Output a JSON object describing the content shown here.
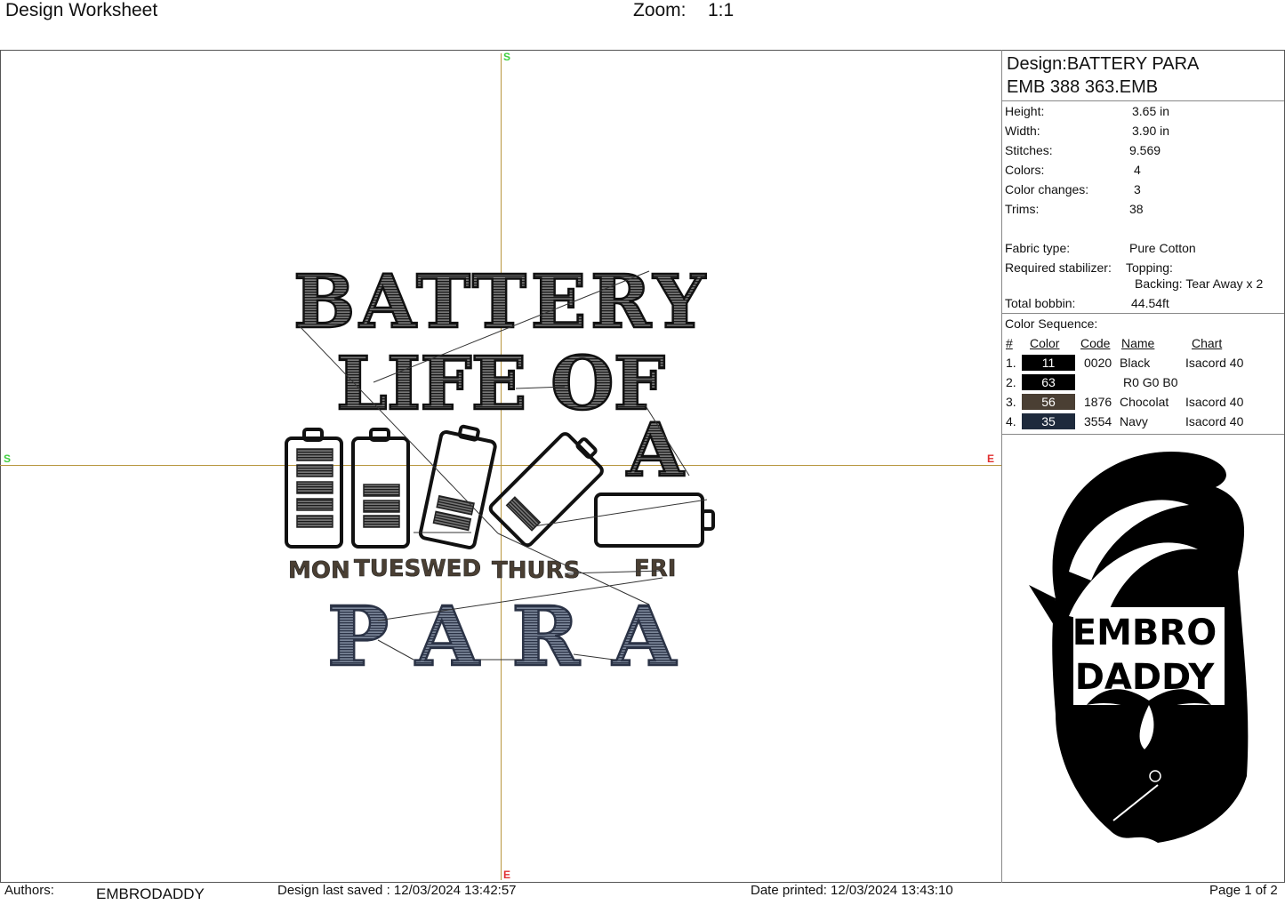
{
  "header": {
    "title": "Design Worksheet",
    "zoom_label": "Zoom:",
    "zoom_value": "1:1"
  },
  "axes": {
    "north": "S",
    "west": "S",
    "east": "E",
    "south": "E"
  },
  "design_art": {
    "line1": "BATTERY",
    "line2": "LIFE OF",
    "line3": "A",
    "days": [
      "MON",
      "TUES",
      "WED",
      "THURS",
      "FRI"
    ],
    "line4": "PARA"
  },
  "panel": {
    "design": "Design:BATTERY PARA",
    "file": "EMB 388 363.EMB",
    "stats": [
      {
        "label": "Height:",
        "value": "3.65 in"
      },
      {
        "label": "Width:",
        "value": "3.90 in"
      },
      {
        "label": "Stitches:",
        "value": "9.569"
      },
      {
        "label": "Colors:",
        "value": "4"
      },
      {
        "label": "Color changes:",
        "value": "3"
      },
      {
        "label": "Trims:",
        "value": "38"
      }
    ],
    "fabric_label": "Fabric type:",
    "fabric_value": "Pure Cotton",
    "stabilizer_label": "Required stabilizer:",
    "topping": "Topping:",
    "backing": "Backing: Tear Away x 2",
    "bobbin_label": "Total bobbin:",
    "bobbin_value": "44.54ft",
    "sequence_title": "Color Sequence:",
    "columns": {
      "num": "#",
      "color": "Color",
      "code": "Code",
      "name": "Name",
      "chart": "Chart"
    },
    "sequence": [
      {
        "num": "1.",
        "swatch": "11",
        "hex": "#000000",
        "code": "0020",
        "name": "Black",
        "chart": "Isacord 40"
      },
      {
        "num": "2.",
        "swatch": "63",
        "hex": "#000000",
        "code": "",
        "name": "R0 G0 B0",
        "chart": ""
      },
      {
        "num": "3.",
        "swatch": "56",
        "hex": "#4a3f33",
        "code": "1876",
        "name": "Chocolat",
        "chart": "Isacord 40"
      },
      {
        "num": "4.",
        "swatch": "35",
        "hex": "#1e2a3c",
        "code": "3554",
        "name": "Navy",
        "chart": "Isacord 40"
      }
    ],
    "logo_text": [
      "EMBRO",
      "DADDY"
    ]
  },
  "footer": {
    "authors_label": "Authors:",
    "authors_value": "EMBRODADDY",
    "saved": "Design last saved : 12/03/2024 13:42:57",
    "printed": "Date printed: 12/03/2024 13:43:10",
    "page": "Page 1 of 2"
  }
}
